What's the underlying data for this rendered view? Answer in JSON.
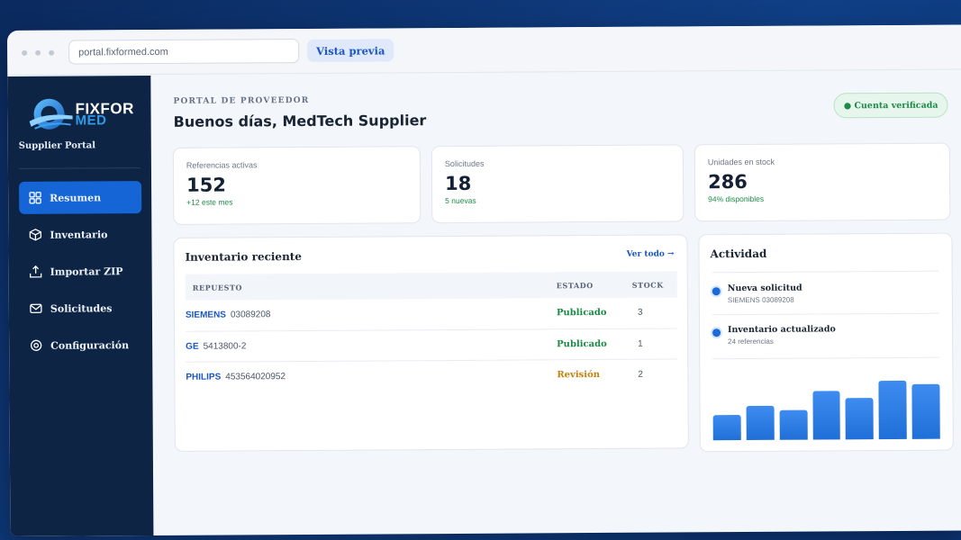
{
  "browser": {
    "url": "portal.fixformed.com",
    "preview_label": "Vista previa"
  },
  "sidebar": {
    "logo_line1": "FIXFOR",
    "logo_line2": "MED",
    "portal_label": "Supplier Portal",
    "items": [
      {
        "label": "Resumen",
        "icon": "grid-icon",
        "active": true
      },
      {
        "label": "Inventario",
        "icon": "box-icon",
        "active": false
      },
      {
        "label": "Importar ZIP",
        "icon": "upload-icon",
        "active": false
      },
      {
        "label": "Solicitudes",
        "icon": "mail-icon",
        "active": false
      },
      {
        "label": "Configuración",
        "icon": "gear-icon",
        "active": false
      }
    ]
  },
  "header": {
    "eyebrow": "PORTAL DE PROVEEDOR",
    "greeting": "Buenos días, MedTech Supplier",
    "verified_badge": "● Cuenta verificada"
  },
  "stats": [
    {
      "label": "Referencias activas",
      "value": "152",
      "sub": "+12 este mes"
    },
    {
      "label": "Solicitudes",
      "value": "18",
      "sub": "5 nuevas"
    },
    {
      "label": "Unidades en stock",
      "value": "286",
      "sub": "94% disponibles"
    }
  ],
  "inventory": {
    "title": "Inventario reciente",
    "see_all": "Ver todo →",
    "columns": [
      "REPUESTO",
      "ESTADO",
      "STOCK"
    ],
    "rows": [
      {
        "brand": "SIEMENS",
        "part": "03089208",
        "status": "Publicado",
        "stock": "3"
      },
      {
        "brand": "GE",
        "part": "5413800-2",
        "status": "Publicado",
        "stock": "1"
      },
      {
        "brand": "PHILIPS",
        "part": "453564020952",
        "status": "Revisión",
        "stock": "2"
      }
    ]
  },
  "activity": {
    "title": "Actividad",
    "items": [
      {
        "title": "Nueva solicitud",
        "sub": "SIEMENS 03089208"
      },
      {
        "title": "Inventario actualizado",
        "sub": "24 referencias"
      }
    ],
    "bar_values": [
      0.42,
      0.58,
      0.5,
      0.82,
      0.7,
      0.98,
      0.92
    ]
  },
  "colors": {
    "accent": "#1565d6",
    "sidebar_bg": "#0d2445",
    "success": "#1d8a48",
    "warning": "#c38212"
  }
}
